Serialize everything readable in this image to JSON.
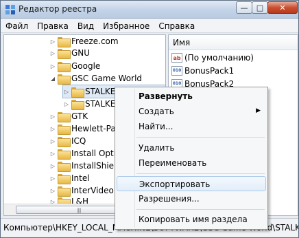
{
  "window": {
    "title": "Редактор реестра",
    "buttons": {
      "minimize": "—",
      "maximize": "□",
      "close": "✕"
    }
  },
  "menubar": [
    "Файл",
    "Правка",
    "Вид",
    "Избранное",
    "Справка"
  ],
  "tree": {
    "items": [
      {
        "label": "Freeze.com"
      },
      {
        "label": "GNU"
      },
      {
        "label": "Google"
      },
      {
        "label": "GSC Game World",
        "expanded": true
      },
      {
        "label": "STALKER-SHOC",
        "selected": true
      },
      {
        "label": "STALKER-SHOC"
      },
      {
        "label": "GTK"
      },
      {
        "label": "Hewlett-Packard"
      },
      {
        "label": "ICQ"
      },
      {
        "label": "Install Options"
      },
      {
        "label": "InstallShield"
      },
      {
        "label": "Intel"
      },
      {
        "label": "InterVideo"
      },
      {
        "label": "L&H"
      }
    ]
  },
  "values_pane": {
    "column_header": "Имя",
    "rows": [
      {
        "icon": "ab",
        "label": "(По умолчанию)"
      },
      {
        "icon": "010",
        "label": "BonusPack1"
      },
      {
        "icon": "010",
        "label": "BonusPack2"
      }
    ]
  },
  "statusbar": {
    "path": "Компьютер\\HKEY_LOCAL_MACHINE\\SOFTWARE\\GSC Game World\\STALKER-SHOC"
  },
  "context_menu": {
    "items": [
      {
        "label": "Развернуть",
        "bold": true
      },
      {
        "label": "Создать",
        "submenu": true
      },
      {
        "label": "Найти..."
      },
      {
        "label": "Удалить"
      },
      {
        "label": "Переименовать"
      },
      {
        "label": "Экспортировать",
        "highlighted": true
      },
      {
        "label": "Разрешения..."
      },
      {
        "label": "Копировать имя раздела"
      }
    ],
    "submenu_arrow": "▶"
  }
}
